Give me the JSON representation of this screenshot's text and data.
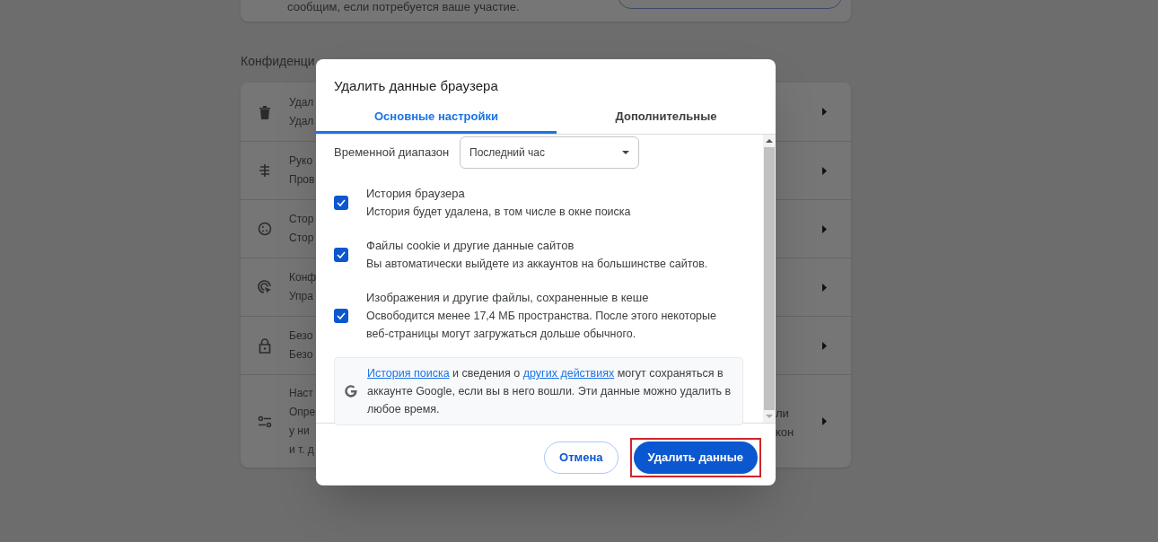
{
  "background_page": {
    "top_card_text": "сообщим, если потребуется ваше участие.",
    "section_heading": "Конфиденци",
    "rows": [
      {
        "lines": [
          "Удал",
          "Удал"
        ]
      },
      {
        "lines": [
          "Руко",
          "Пров"
        ]
      },
      {
        "lines": [
          "Стор",
          "Стор"
        ]
      },
      {
        "lines": [
          "Конф",
          "Упра"
        ]
      },
      {
        "lines": [
          "Безо",
          "Безо"
        ]
      },
      {
        "lines": [
          "Наст",
          "Опре",
          "у ни",
          "и т. д"
        ],
        "right_lines": [
          "ли",
          "кон"
        ]
      }
    ]
  },
  "dialog": {
    "title": "Удалить данные браузера",
    "tabs": [
      {
        "label": "Основные настройки",
        "selected": true
      },
      {
        "label": "Дополнительные",
        "selected": false
      }
    ],
    "time_range": {
      "label": "Временной диапазон",
      "value": "Последний час"
    },
    "options": [
      {
        "title": "История браузера",
        "description": "История будет удалена, в том числе в окне поиска",
        "checked": true
      },
      {
        "title": "Файлы cookie и другие данные сайтов",
        "description": "Вы автоматически выйдете из аккаунтов на большинстве сайтов.",
        "checked": true
      },
      {
        "title": "Изображения и другие файлы, сохраненные в кеше",
        "description": "Освободится менее 17,4 МБ пространства. После этого некоторые веб-страницы могут загружаться дольше обычного.",
        "checked": true
      }
    ],
    "info": {
      "segments": [
        {
          "text": "История поиска",
          "link": true
        },
        {
          "text": " и сведения о ",
          "link": false
        },
        {
          "text": "других действиях",
          "link": true
        },
        {
          "text": " могут сохраняться в аккаунте Google, если вы в него вошли. Эти данные можно удалить в любое время.",
          "link": false
        }
      ]
    },
    "buttons": [
      {
        "label": "Отмена",
        "kind": "secondary",
        "highlighted": false
      },
      {
        "label": "Удалить данные",
        "kind": "primary",
        "highlighted": true
      }
    ]
  }
}
